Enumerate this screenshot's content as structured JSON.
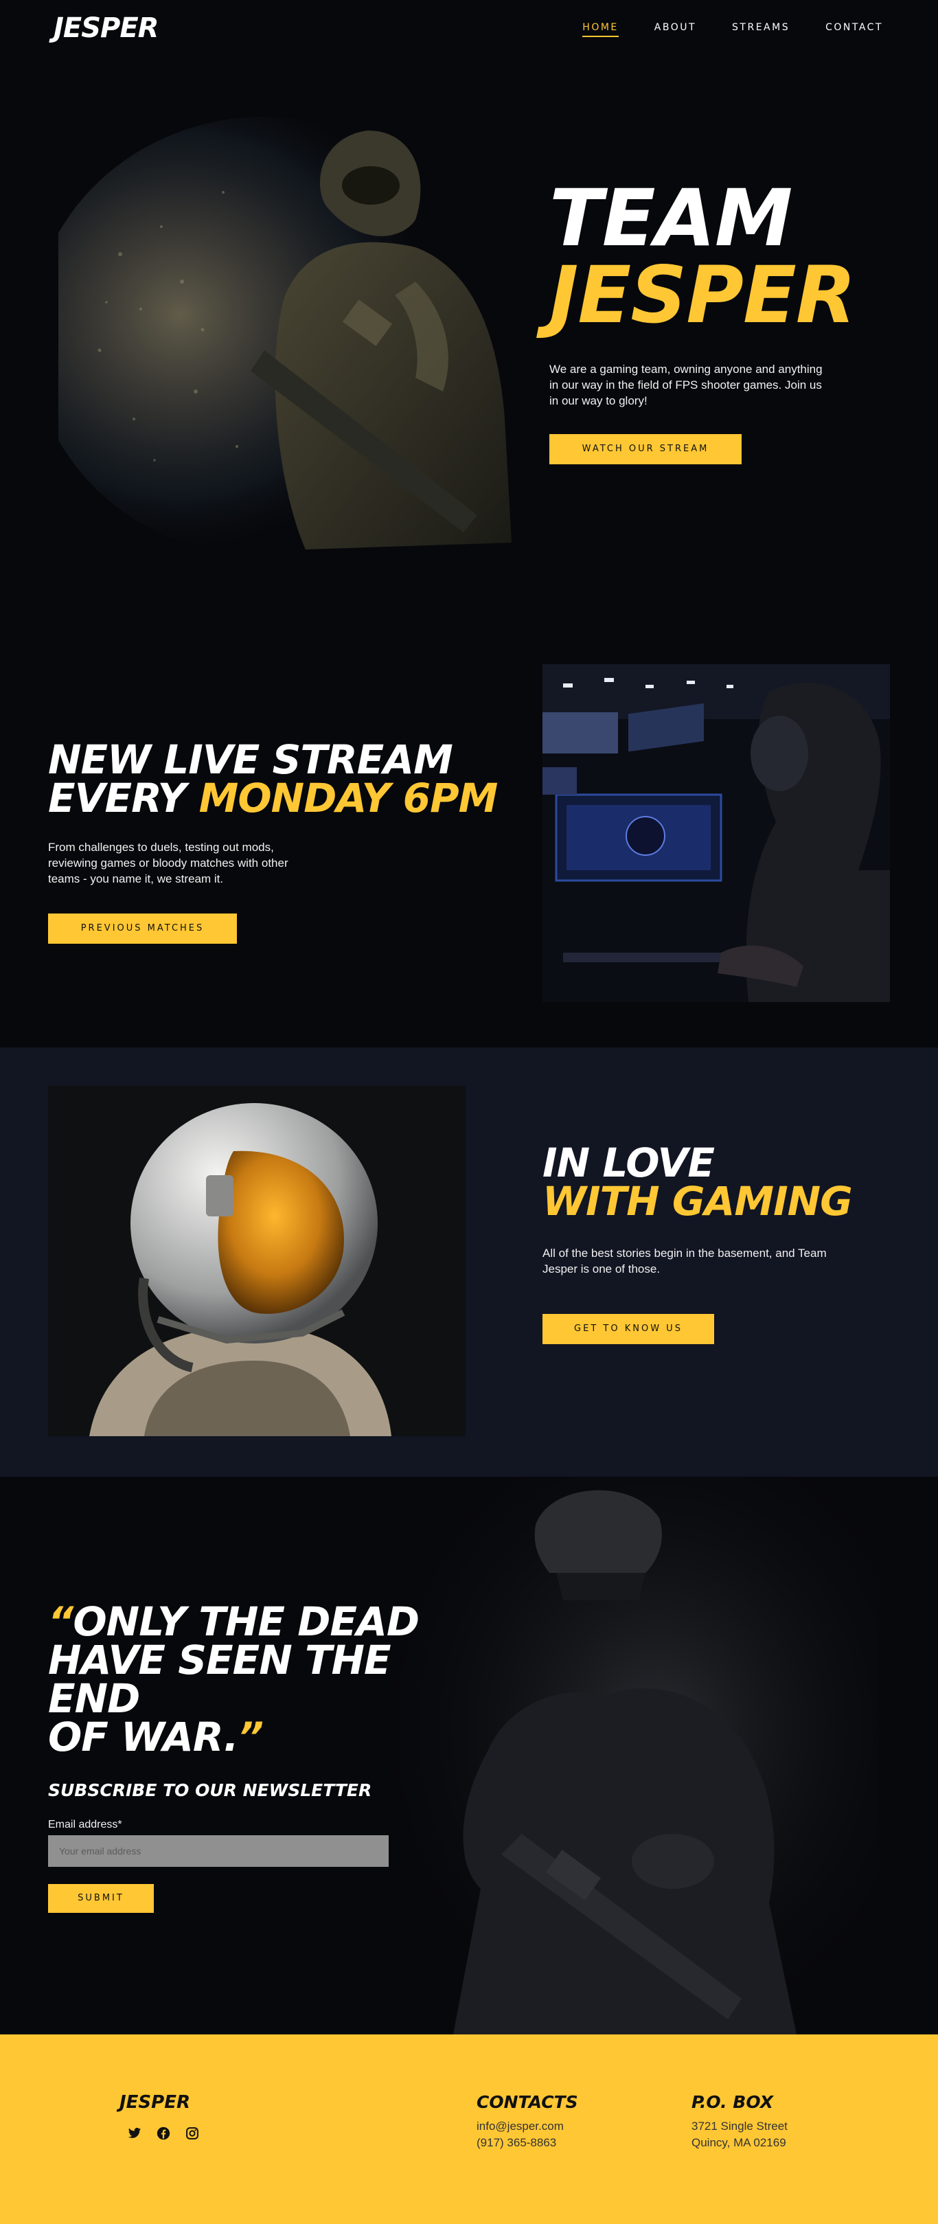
{
  "header": {
    "logo": "JESPER",
    "nav": [
      "HOME",
      "ABOUT",
      "STREAMS",
      "CONTACT"
    ],
    "active_nav": "HOME"
  },
  "hero": {
    "title_line1": "TEAM",
    "title_line2": "JESPER",
    "text": "We are a gaming team, owning anyone and anything in our way in the field of FPS shooter games. Join us in our way to glory!",
    "button": "WATCH OUR STREAM"
  },
  "stream": {
    "title_line1": "NEW LIVE STREAM",
    "title_line2_prefix": "EVERY ",
    "title_line2_highlight": "MONDAY 6PM",
    "text": "From challenges to duels, testing out mods, reviewing games or bloody matches with other teams - you name it, we stream it.",
    "button": "PREVIOUS MATCHES"
  },
  "love": {
    "title_line1": "IN LOVE",
    "title_line2": "WITH GAMING",
    "text": "All of the best stories begin in the basement, and Team Jesper is one of those.",
    "button": "GET TO KNOW US"
  },
  "quote": {
    "open_mark": "“",
    "line1": "ONLY THE DEAD",
    "line2": "HAVE SEEN THE END",
    "line3": "OF WAR.",
    "close_mark": "”"
  },
  "newsletter": {
    "title": "SUBSCRIBE TO OUR NEWSLETTER",
    "label": "Email address*",
    "placeholder": "Your email address",
    "button": "SUBMIT"
  },
  "footer": {
    "logo": "JESPER",
    "socials": [
      "twitter-icon",
      "facebook-icon",
      "instagram-icon"
    ],
    "contacts_title": "CONTACTS",
    "email": "info@jesper.com",
    "phone": "(917) 365-8863",
    "pobox_title": "P.O. BOX",
    "street": "3721 Single Street",
    "city": "Quincy, MA 02169"
  },
  "colors": {
    "accent": "#ffc734",
    "background": "#07080c",
    "section_alt": "#121522"
  }
}
